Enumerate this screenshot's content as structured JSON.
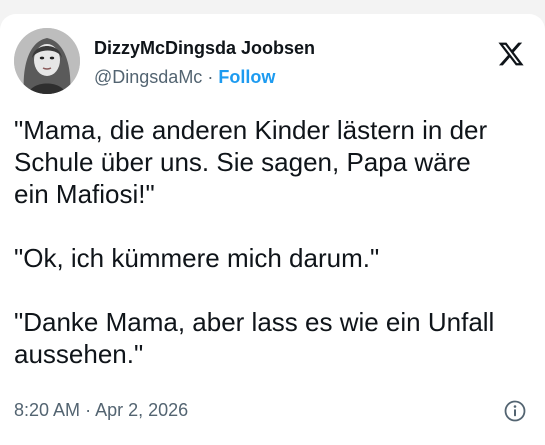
{
  "author": {
    "display_name": "DizzyMcDingsda Joobsen",
    "handle": "@DingsdaMc",
    "separator": "·",
    "follow_label": "Follow"
  },
  "icons": {
    "brand": "x-logo-icon",
    "info": "info-icon"
  },
  "tweet": {
    "paragraphs": [
      "\"Mama, die anderen Kinder lästern in der\nSchule über uns. Sie sagen, Papa wäre\nein Mafiosi!\"",
      "\"Ok, ich kümmere mich darum.\"",
      "\"Danke Mama, aber lass es wie ein Unfall\naussehen.\""
    ],
    "time": "8:20 AM",
    "separator": "·",
    "date": "Apr 2, 2026"
  },
  "colors": {
    "accent": "#1d9bf0",
    "text": "#0f1419",
    "secondary": "#536471"
  }
}
